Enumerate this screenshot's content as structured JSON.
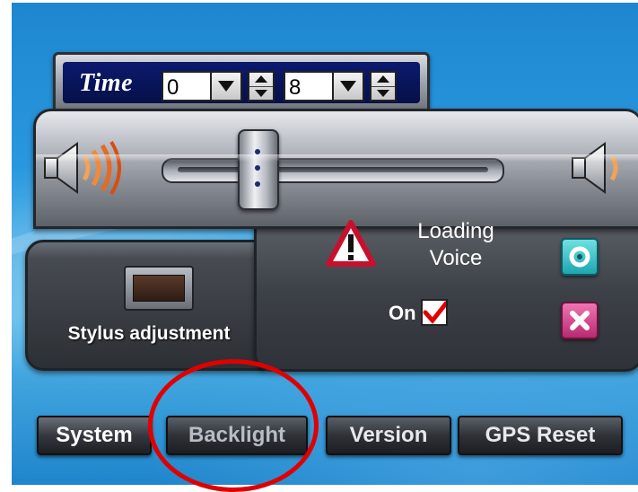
{
  "time": {
    "label": "Time",
    "hour_value": "0",
    "minute_value": "8"
  },
  "volume": {
    "level": 0.28
  },
  "loading_voice": {
    "line1": "Loading",
    "line2": "Voice",
    "on_label": "On",
    "checked": true
  },
  "stylus": {
    "label": "Stylus adjustment"
  },
  "tabs": [
    {
      "label": "System",
      "state": "active"
    },
    {
      "label": "Backlight",
      "state": "highlighted"
    },
    {
      "label": "Version",
      "state": "normal"
    },
    {
      "label": "GPS Reset",
      "state": "normal"
    }
  ],
  "colors": {
    "highlight_circle": "#e00000",
    "ok_button": "#1fa6b0",
    "cancel_button": "#b72a70",
    "time_bar": "#0b1a6e"
  },
  "icons": {
    "speaker_loud": "speaker-loud-icon",
    "speaker_quiet": "speaker-quiet-icon",
    "warning": "warning-icon",
    "ok": "ok-icon",
    "cancel": "close-icon",
    "check": "checkmark-icon"
  }
}
